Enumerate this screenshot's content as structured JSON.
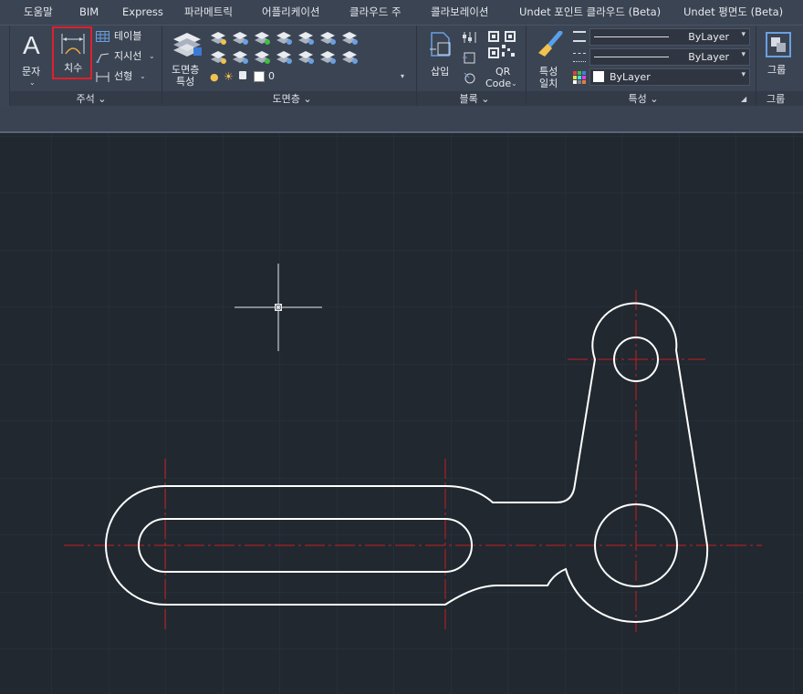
{
  "menu": {
    "tabs": [
      "도움말",
      "BIM",
      "Express",
      "파라메트릭",
      "어플리케이션",
      "클라우드 주",
      "콜라보레이션",
      "Undet 포인트 클라우드 (Beta)",
      "Undet 평면도 (Beta)"
    ]
  },
  "ribbon": {
    "annotation": {
      "text_label": "문자",
      "dimension_label": "치수",
      "table_label": "테이블",
      "leader_label": "지시선",
      "linear_label": "선형",
      "panel_label": "주석"
    },
    "layers": {
      "props_label_1": "도면층",
      "props_label_2": "특성",
      "current_layer": "0",
      "panel_label": "도면층"
    },
    "block": {
      "insert_label": "삽입",
      "qr_label_1": "QR",
      "qr_label_2": "Code",
      "panel_label": "블록"
    },
    "properties": {
      "match_label_1": "특성",
      "match_label_2": "일치",
      "linetype_value": "ByLayer",
      "lineweight_value": "ByLayer",
      "color_value": "ByLayer",
      "panel_label": "특성"
    },
    "group": {
      "group_label": "그룹",
      "panel_label": "그룹"
    }
  },
  "colors": {
    "highlight": "#e0202a",
    "centerline": "#c81e1e",
    "drawing": "#ffffff",
    "background": "#212830",
    "ribbon": "#3b4453"
  }
}
